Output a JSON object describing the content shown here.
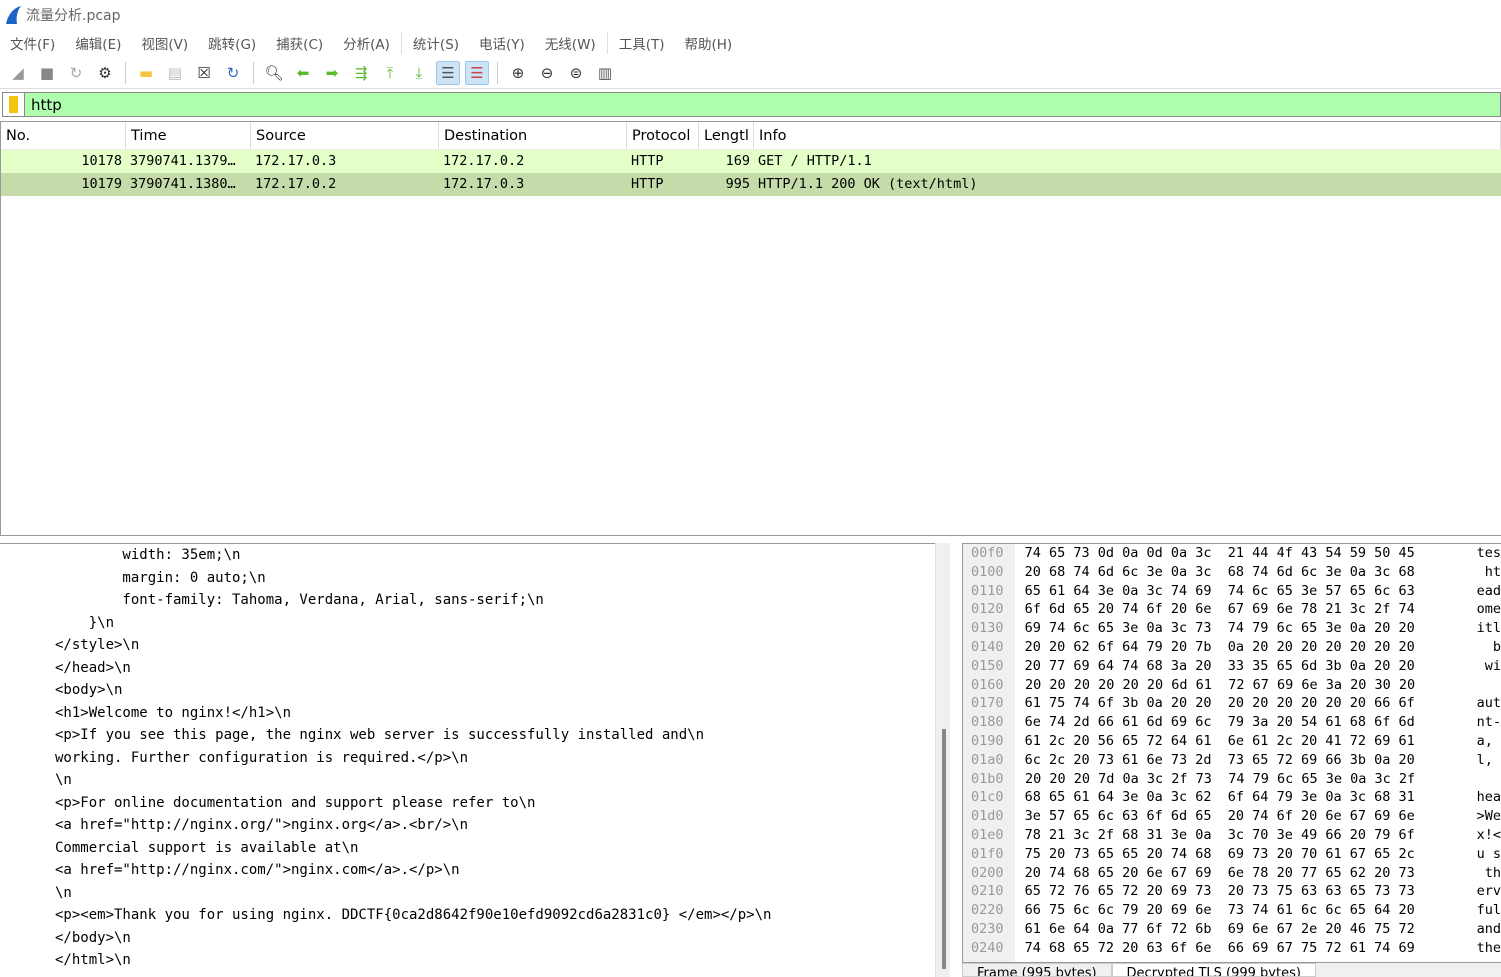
{
  "window": {
    "title": "流量分析.pcap"
  },
  "menu": [
    "文件(F)",
    "编辑(E)",
    "视图(V)",
    "跳转(G)",
    "捕获(C)",
    "分析(A)",
    "统计(S)",
    "电话(Y)",
    "无线(W)",
    "工具(T)",
    "帮助(H)"
  ],
  "toolbar": [
    {
      "icon": "start-capture-icon",
      "glyph": "◢",
      "color": "#999"
    },
    {
      "icon": "stop-capture-icon",
      "glyph": "■",
      "color": "#888"
    },
    {
      "icon": "restart-capture-icon",
      "glyph": "↻",
      "color": "#aaa"
    },
    {
      "icon": "capture-options-icon",
      "glyph": "⚙",
      "color": "#333"
    },
    {
      "sep": true
    },
    {
      "icon": "open-file-icon",
      "glyph": "▬",
      "color": "#f5c542"
    },
    {
      "icon": "save-file-icon",
      "glyph": "▤",
      "color": "#bbb"
    },
    {
      "icon": "close-file-icon",
      "glyph": "☒",
      "color": "#333"
    },
    {
      "icon": "reload-file-icon",
      "glyph": "↻",
      "color": "#2a6fc4"
    },
    {
      "sep": true
    },
    {
      "icon": "find-packet-icon",
      "glyph": "🔍︎",
      "color": "#333"
    },
    {
      "icon": "go-back-icon",
      "glyph": "⬅",
      "color": "#5cb82e"
    },
    {
      "icon": "go-forward-icon",
      "glyph": "➡",
      "color": "#5cb82e"
    },
    {
      "icon": "go-to-packet-icon",
      "glyph": "⇶",
      "color": "#5cb82e"
    },
    {
      "icon": "first-packet-icon",
      "glyph": "⤒",
      "color": "#5cb82e"
    },
    {
      "icon": "last-packet-icon",
      "glyph": "⤓",
      "color": "#5cb82e"
    },
    {
      "icon": "auto-scroll-icon",
      "glyph": "☰",
      "color": "#555",
      "active": true
    },
    {
      "icon": "colorize-icon",
      "glyph": "☰",
      "color": "#c44",
      "active": true
    },
    {
      "sep": true
    },
    {
      "icon": "zoom-in-icon",
      "glyph": "⊕",
      "color": "#333"
    },
    {
      "icon": "zoom-out-icon",
      "glyph": "⊖",
      "color": "#333"
    },
    {
      "icon": "zoom-reset-icon",
      "glyph": "⊜",
      "color": "#333"
    },
    {
      "icon": "resize-columns-icon",
      "glyph": "▥",
      "color": "#555"
    }
  ],
  "filter": {
    "value": "http",
    "bg": "#afffaf"
  },
  "packet_list": {
    "columns": [
      "No.",
      "Time",
      "Source",
      "Destination",
      "Protocol",
      "Lengtl",
      "Info"
    ],
    "rows": [
      {
        "no": "10178",
        "time": "3790741.1379…",
        "src": "172.17.0.3",
        "dst": "172.17.0.2",
        "proto": "HTTP",
        "len": "169",
        "info": "GET / HTTP/1.1"
      },
      {
        "no": "10179",
        "time": "3790741.1380…",
        "src": "172.17.0.2",
        "dst": "172.17.0.3",
        "proto": "HTTP",
        "len": "995",
        "info": "HTTP/1.1 200 OK  (text/html)",
        "selected": true
      }
    ]
  },
  "details": [
    "        width: 35em;\\n",
    "        margin: 0 auto;\\n",
    "        font-family: Tahoma, Verdana, Arial, sans-serif;\\n",
    "    }\\n",
    "</style>\\n",
    "</head>\\n",
    "<body>\\n",
    "<h1>Welcome to nginx!</h1>\\n",
    "<p>If you see this page, the nginx web server is successfully installed and\\n",
    "working. Further configuration is required.</p>\\n",
    "\\n",
    "<p>For online documentation and support please refer to\\n",
    "<a href=\"http://nginx.org/\">nginx.org</a>.<br/>\\n",
    "Commercial support is available at\\n",
    "<a href=\"http://nginx.com/\">nginx.com</a>.</p>\\n",
    "\\n",
    "<p><em>Thank you for using nginx. DDCTF{0ca2d8642f90e10efd9092cd6a2831c0} </em></p>\\n",
    "</body>\\n",
    "</html>\\n"
  ],
  "hex": [
    {
      "off": "00f0",
      "bytes": "74 65 73 0d 0a 0d 0a 3c  21 44 4f 43 54 59 50 45",
      "ascii": "tes"
    },
    {
      "off": "0100",
      "bytes": "20 68 74 6d 6c 3e 0a 3c  68 74 6d 6c 3e 0a 3c 68",
      "ascii": " ht"
    },
    {
      "off": "0110",
      "bytes": "65 61 64 3e 0a 3c 74 69  74 6c 65 3e 57 65 6c 63",
      "ascii": "ead"
    },
    {
      "off": "0120",
      "bytes": "6f 6d 65 20 74 6f 20 6e  67 69 6e 78 21 3c 2f 74",
      "ascii": "ome"
    },
    {
      "off": "0130",
      "bytes": "69 74 6c 65 3e 0a 3c 73  74 79 6c 65 3e 0a 20 20",
      "ascii": "itl"
    },
    {
      "off": "0140",
      "bytes": "20 20 62 6f 64 79 20 7b  0a 20 20 20 20 20 20 20",
      "ascii": "  b"
    },
    {
      "off": "0150",
      "bytes": "20 77 69 64 74 68 3a 20  33 35 65 6d 3b 0a 20 20",
      "ascii": " wi"
    },
    {
      "off": "0160",
      "bytes": "20 20 20 20 20 20 6d 61  72 67 69 6e 3a 20 30 20",
      "ascii": ""
    },
    {
      "off": "0170",
      "bytes": "61 75 74 6f 3b 0a 20 20  20 20 20 20 20 20 66 6f",
      "ascii": "aut"
    },
    {
      "off": "0180",
      "bytes": "6e 74 2d 66 61 6d 69 6c  79 3a 20 54 61 68 6f 6d",
      "ascii": "nt-"
    },
    {
      "off": "0190",
      "bytes": "61 2c 20 56 65 72 64 61  6e 61 2c 20 41 72 69 61",
      "ascii": "a, "
    },
    {
      "off": "01a0",
      "bytes": "6c 2c 20 73 61 6e 73 2d  73 65 72 69 66 3b 0a 20",
      "ascii": "l, "
    },
    {
      "off": "01b0",
      "bytes": "20 20 20 7d 0a 3c 2f 73  74 79 6c 65 3e 0a 3c 2f",
      "ascii": ""
    },
    {
      "off": "01c0",
      "bytes": "68 65 61 64 3e 0a 3c 62  6f 64 79 3e 0a 3c 68 31",
      "ascii": "hea"
    },
    {
      "off": "01d0",
      "bytes": "3e 57 65 6c 63 6f 6d 65  20 74 6f 20 6e 67 69 6e",
      "ascii": ">We"
    },
    {
      "off": "01e0",
      "bytes": "78 21 3c 2f 68 31 3e 0a  3c 70 3e 49 66 20 79 6f",
      "ascii": "x!<"
    },
    {
      "off": "01f0",
      "bytes": "75 20 73 65 65 20 74 68  69 73 20 70 61 67 65 2c",
      "ascii": "u s"
    },
    {
      "off": "0200",
      "bytes": "20 74 68 65 20 6e 67 69  6e 78 20 77 65 62 20 73",
      "ascii": " th"
    },
    {
      "off": "0210",
      "bytes": "65 72 76 65 72 20 69 73  20 73 75 63 63 65 73 73",
      "ascii": "erv"
    },
    {
      "off": "0220",
      "bytes": "66 75 6c 6c 79 20 69 6e  73 74 61 6c 6c 65 64 20",
      "ascii": "ful"
    },
    {
      "off": "0230",
      "bytes": "61 6e 64 0a 77 6f 72 6b  69 6e 67 2e 20 46 75 72",
      "ascii": "and"
    },
    {
      "off": "0240",
      "bytes": "74 68 65 72 20 63 6f 6e  66 69 67 75 72 61 74 69",
      "ascii": "the"
    }
  ],
  "byte_tabs": [
    "Frame (995 bytes)",
    "Decrypted TLS (999 bytes)"
  ]
}
